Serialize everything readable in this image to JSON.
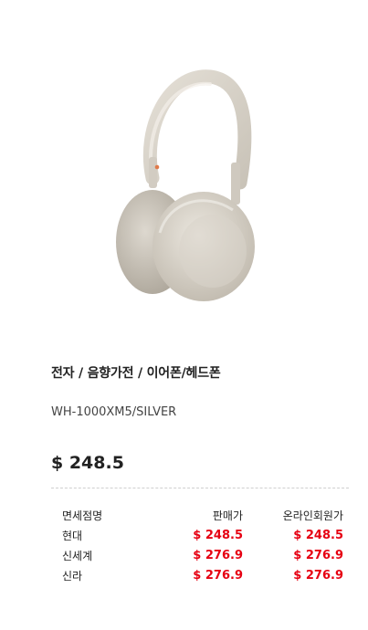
{
  "product": {
    "image_name": "headphones-silver",
    "category": "전자 / 음향가전 / 이어폰/헤드폰",
    "model": "WH-1000XM5/SILVER",
    "price": "$ 248.5"
  },
  "price_table": {
    "headers": {
      "store": "면세점명",
      "sale": "판매가",
      "online": "온라인회원가"
    },
    "rows": [
      {
        "store": "현대",
        "sale": "$ 248.5",
        "online": "$ 248.5"
      },
      {
        "store": "신세계",
        "sale": "$ 276.9",
        "online": "$ 276.9"
      },
      {
        "store": "신라",
        "sale": "$ 276.9",
        "online": "$ 276.9"
      }
    ]
  },
  "colors": {
    "price_red": "#e60012",
    "text": "#222222"
  }
}
